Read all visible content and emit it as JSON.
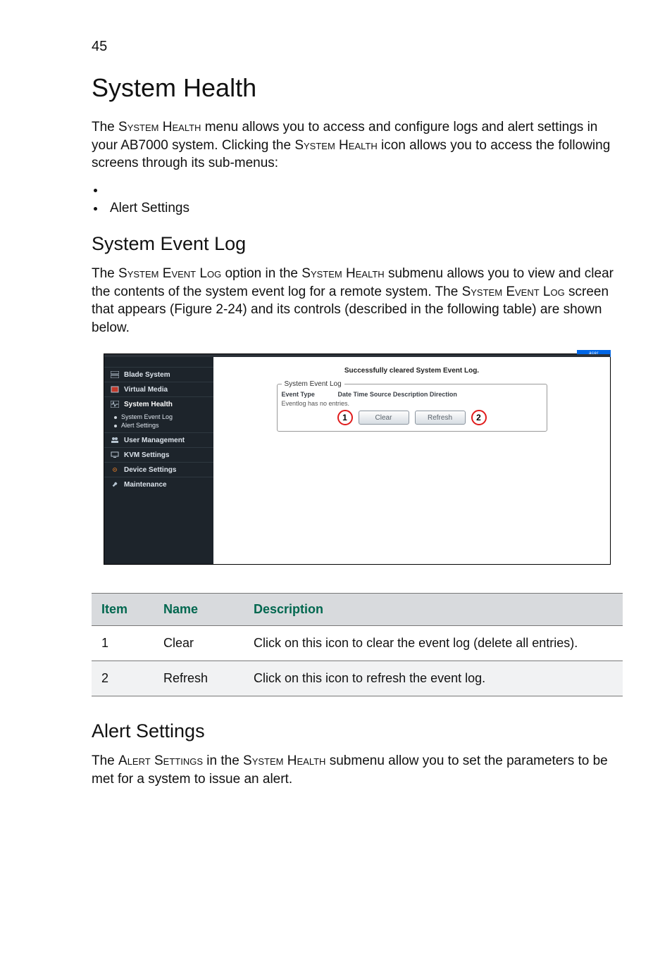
{
  "page_number": "45",
  "heading": "System Health",
  "intro": {
    "p1_a": "The ",
    "p1_b": "System Health",
    "p1_c": " menu allows you to access and configure logs and alert settings in your AB7000 system. Clicking the ",
    "p1_d": "System Health",
    "p1_e": " icon allows you to access the following screens through its sub-menus:"
  },
  "bullets": [
    "",
    "Alert Settings"
  ],
  "section1": {
    "title": "System Event Log",
    "p_a": "The ",
    "p_b": "System Event Log",
    "p_c": " option in the ",
    "p_d": "System Health",
    "p_e": " submenu allows you to view and clear the contents of the system event log for a remote system. The ",
    "p_f": "System Event Log",
    "p_g": " screen that appears (Figure 2-24) and its controls (described in the following table) are shown below."
  },
  "screenshot": {
    "tab_text": "acer",
    "nav": {
      "blade": "Blade System",
      "virtual": "Virtual Media",
      "health": "System Health",
      "sub_sel": "System Event Log",
      "sub_alert": "Alert Settings",
      "user": "User Management",
      "kvm": "KVM Settings",
      "device": "Device Settings",
      "maint": "Maintenance"
    },
    "status": "Successfully cleared System Event Log.",
    "legend": "System Event Log",
    "cols": {
      "type": "Event Type",
      "rest": "Date  Time  Source  Description  Direction"
    },
    "empty": "Eventlog has no entries.",
    "btn_clear": "Clear",
    "btn_refresh": "Refresh",
    "marker1": "1",
    "marker2": "2"
  },
  "table": {
    "headers": {
      "item": "Item",
      "name": "Name",
      "desc": "Description"
    },
    "rows": [
      {
        "item": "1",
        "name": "Clear",
        "desc": "Click on this icon to clear the event log (delete all entries)."
      },
      {
        "item": "2",
        "name": "Refresh",
        "desc": "Click on this icon to refresh the event log."
      }
    ]
  },
  "section2": {
    "title": "Alert Settings",
    "p_a": "The ",
    "p_b": "Alert Settings",
    "p_c": " in the ",
    "p_d": "System Health",
    "p_e": " submenu allow you to set the parameters to be met for a system to issue an alert."
  }
}
